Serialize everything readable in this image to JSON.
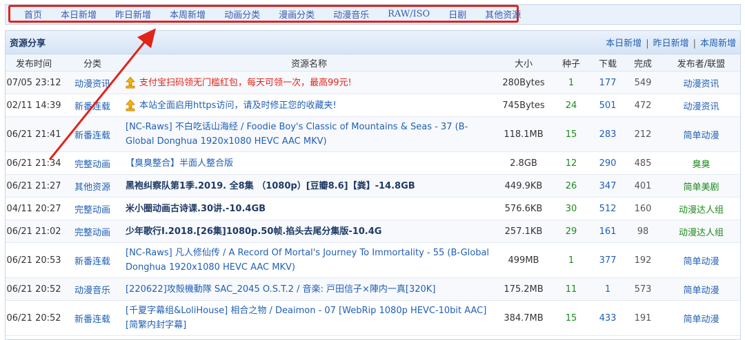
{
  "nav": {
    "items": [
      "首页",
      "本日新增",
      "昨日新增",
      "本周新增",
      "动画分类",
      "漫画分类",
      "动漫音乐",
      "RAW/ISO",
      "日剧",
      "其他资源"
    ]
  },
  "panel": {
    "title": "资源分享",
    "links": [
      "本日新增",
      "昨日新增",
      "本周新增"
    ]
  },
  "table": {
    "headers": [
      "发布时间",
      "分类",
      "资源名称",
      "大小",
      "种子",
      "下载",
      "完成",
      "发布者/联盟"
    ],
    "rows": [
      {
        "time": "07/05 23:12",
        "category": "动漫资讯",
        "title": "支付宝扫码领无门槛红包，每天可领一次，最高99元!",
        "size": "280Bytes",
        "seeds": "1",
        "downloads": "177",
        "completed": "549",
        "publisher": "动漫资讯"
      },
      {
        "time": "02/11 14:39",
        "category": "新番连载",
        "title": "本站全面启用https访问，请及时修正您的收藏夹!",
        "size": "745Bytes",
        "seeds": "24",
        "downloads": "501",
        "completed": "472",
        "publisher": "动漫资讯"
      },
      {
        "time": "06/21 21:41",
        "category": "新番连载",
        "title": "[NC-Raws] 不白吃话山海经 / Foodie Boy's Classic of Mountains & Seas - 37 (B-Global Donghua 1920x1080 HEVC AAC MKV)",
        "size": "118.1MB",
        "seeds": "15",
        "downloads": "283",
        "completed": "212",
        "publisher": "简单动漫"
      },
      {
        "time": "06/21 21:34",
        "category": "完整动画",
        "title": "【臭臭整合】半面人整合版",
        "size": "2.8GB",
        "seeds": "12",
        "downloads": "290",
        "completed": "485",
        "publisher": "臭臭"
      },
      {
        "time": "06/21 21:27",
        "category": "其他资源",
        "title": "黑袍纠察队第1季.2019. 全8集 （1080p）[豆瓣8.6]【粪】-14.8GB",
        "size": "449.9KB",
        "seeds": "26",
        "downloads": "347",
        "completed": "401",
        "publisher": "简单美剧"
      },
      {
        "time": "04/11 20:27",
        "category": "完整动画",
        "title": "米小圈动画古诗课.30讲.-10.4GB",
        "size": "576.6KB",
        "seeds": "30",
        "downloads": "512",
        "completed": "160",
        "publisher": "动漫达人组"
      },
      {
        "time": "06/21 21:02",
        "category": "完整动画",
        "title": "少年歌行I.2018.[26集]1080p.50帧.掐头去尾分集版-10.4G",
        "size": "257.1KB",
        "seeds": "29",
        "downloads": "161",
        "completed": "98",
        "publisher": "动漫达人组"
      },
      {
        "time": "06/21 20:53",
        "category": "新番连载",
        "title": "[NC-Raws] 凡人修仙传 / A Record Of Mortal's Journey To Immortality - 55 (B-Global Donghua 1920x1080 HEVC AAC MKV)",
        "size": "499MB",
        "seeds": "1",
        "downloads": "377",
        "completed": "192",
        "publisher": "简单动漫"
      },
      {
        "time": "06/21 20:52",
        "category": "动漫音乐",
        "title": "[220622]攻殻機動隊 SAC_2045 O.S.T.2 / 音楽: 戸田信子×陣内一真[320K]",
        "size": "175.2MB",
        "seeds": "11",
        "downloads": "1",
        "completed": "573",
        "publisher": "简单动漫"
      },
      {
        "time": "06/21 20:52",
        "category": "新番连载",
        "title": "[千夏字幕组&LoliHouse] 相合之物 / Deaimon - 07 [WebRip 1080p HEVC-10bit AAC][简繁内封字幕]",
        "size": "384.7MB",
        "seeds": "15",
        "downloads": "433",
        "completed": "191",
        "publisher": "简单动漫"
      }
    ]
  },
  "colors": {
    "accent": "#1f5fb5",
    "highlight": "#e2231a",
    "seed": "#1a8a1a"
  },
  "icons": {
    "pin": "pin-icon"
  }
}
